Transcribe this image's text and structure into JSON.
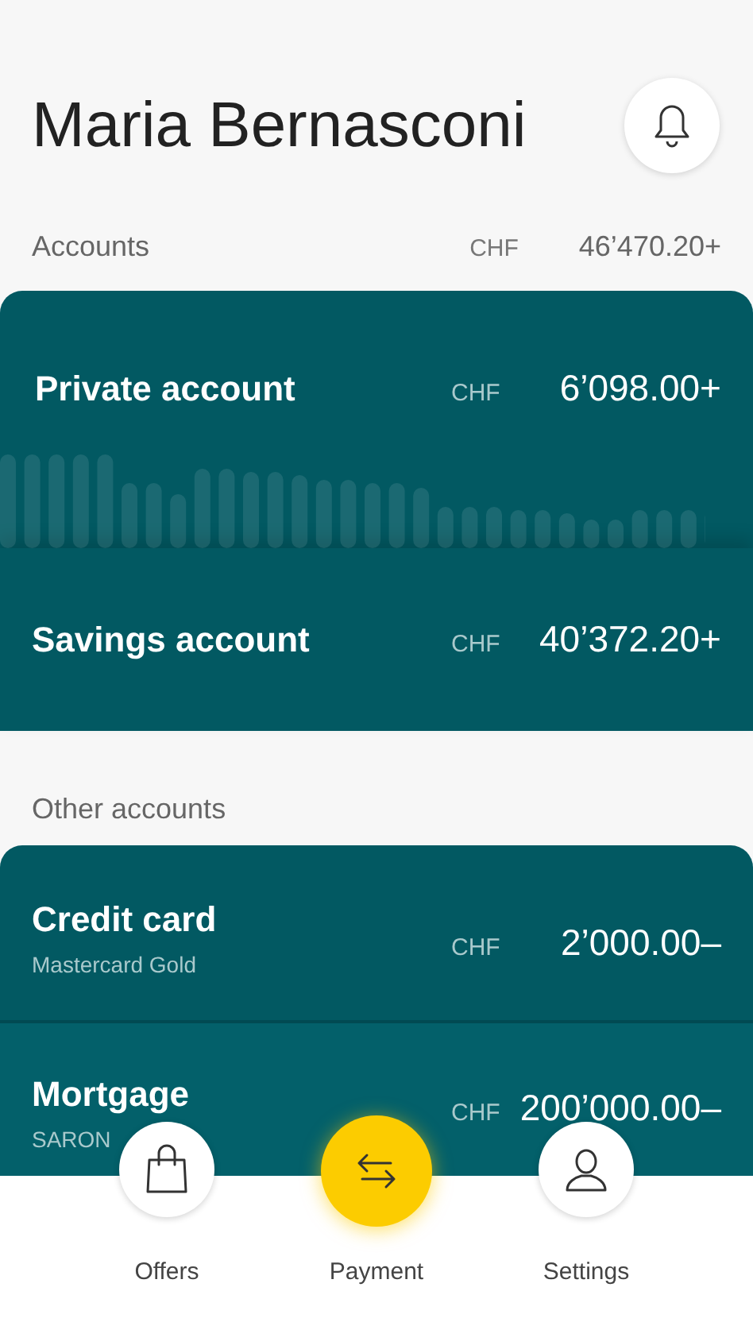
{
  "header": {
    "title": "Maria Bernasconi"
  },
  "accounts_summary": {
    "label": "Accounts",
    "currency": "CHF",
    "amount": "46’470.20+"
  },
  "accounts": [
    {
      "name": "Private account",
      "currency": "CHF",
      "amount": "6’098.00+",
      "kind": "graph"
    },
    {
      "name": "Savings account",
      "currency": "CHF",
      "amount": "40’372.20+",
      "kind": "plain"
    }
  ],
  "other_accounts": {
    "label": "Other accounts"
  },
  "other": [
    {
      "name": "Credit card",
      "subtitle": "Mastercard Gold",
      "currency": "CHF",
      "amount": "2’000.00–"
    },
    {
      "name": "Mortgage",
      "subtitle": "SARON",
      "currency": "CHF",
      "amount": "200’000.00–"
    }
  ],
  "nav": [
    {
      "label": "Offers",
      "kind": "offers",
      "selected": false
    },
    {
      "label": "Payment",
      "kind": "payment",
      "selected": true
    },
    {
      "label": "Settings",
      "kind": "settings",
      "selected": false
    }
  ]
}
